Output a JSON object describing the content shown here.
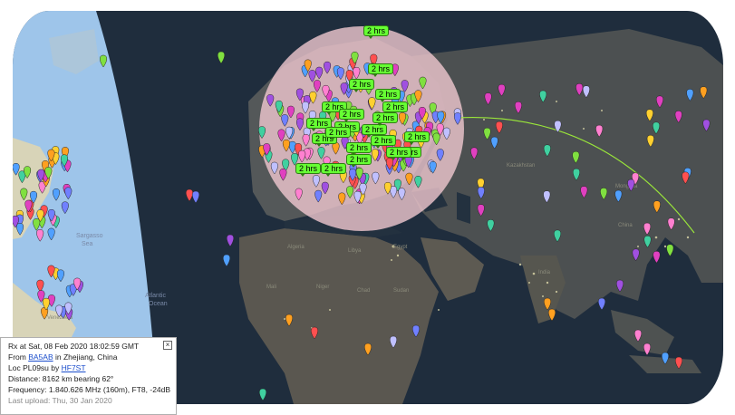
{
  "map": {
    "labels": {
      "sargasso": "Sargasso",
      "sea": "Sea",
      "atlantic": "Atlantic",
      "ocean": "Ocean",
      "venezuela": "Venezuela",
      "algeria": "Algeria",
      "libya": "Libya",
      "egypt": "Egypt",
      "mali": "Mali",
      "niger": "Niger",
      "chad": "Chad",
      "sudan": "Sudan",
      "kazakhstan": "Kazakhstan",
      "mongolia": "Mongolia",
      "china": "China",
      "india": "India"
    },
    "range_tags": [
      "2 hrs",
      "2 hrs",
      "2 hrs",
      "2 hrs",
      "2 hrs",
      "2 hrs",
      "2 hrs",
      "2 hrs",
      "2 hrs",
      "2 hrs",
      "2 hrs",
      "2 hrs",
      "2 hrs",
      "2 hrs",
      "2 hrs",
      "2 hrs",
      "2 hrs",
      "2 hrs",
      "2 hrs",
      "2 hrs",
      "2 hrs"
    ],
    "colors": {
      "ocean": "#1f2d3d",
      "land": "#4a4e4f",
      "daylight_ocean": "#9ec5ea",
      "range_circle": "#f0c8cf",
      "path": "#9ae63a",
      "tag": "#66ff33"
    }
  },
  "info": {
    "line1": "Rx at Sat, 08 Feb 2020 18:02:59 GMT",
    "from_prefix": "From ",
    "from_call": "BA5AB",
    "from_suffix": " in Zhejiang, China",
    "loc_prefix": "Loc PL09su by ",
    "loc_call": "HF7ST",
    "distance": "Distance: 8162 km bearing 62°",
    "frequency": "Frequency: 1.840.626 MHz (160m), FT8, -24dB",
    "upload": "Last upload: Thu, 30 Jan 2020",
    "close": "×"
  }
}
